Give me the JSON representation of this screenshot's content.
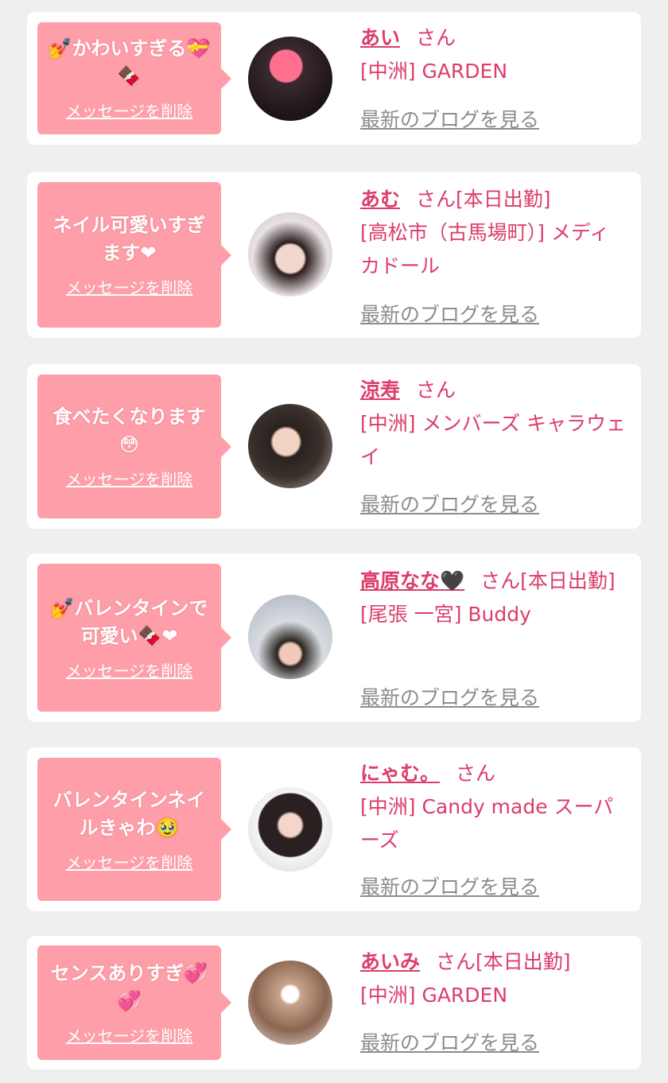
{
  "colors": {
    "background": "#efefef",
    "card": "#ffffff",
    "bubble": "#fd9ea8",
    "name_text": "#dc3d6a",
    "blog_link": "#8c8c8c"
  },
  "delete_label": "メッセージを削除",
  "blog_label": "最新のブログを見る",
  "san_label": "さん",
  "entries": [
    {
      "message": "💅かわいすぎる💝🍫",
      "name": "あい",
      "status": "",
      "shop": "[中洲] GARDEN"
    },
    {
      "message": "ネイル可愛いすぎます❤",
      "name": "あむ",
      "status": "[本日出勤]",
      "shop": "[高松市（古馬場町）] メディカドール"
    },
    {
      "message": "食べたくなります😳",
      "name": "涼寿",
      "status": "",
      "shop": "[中洲] メンバーズ キャラウェイ"
    },
    {
      "message": "💅バレンタインで可愛い🍫❤",
      "name": "高原なな🖤",
      "status": "[本日出勤]",
      "shop": "[尾張 一宮] Buddy"
    },
    {
      "message": "バレンタインネイルきゃわ🥹",
      "name": "にゃむ。",
      "status": "",
      "shop": "[中洲] Candy made スーパーズ"
    },
    {
      "message": "センスありすぎ💞💞",
      "name": "あいみ",
      "status": "[本日出勤]",
      "shop": "[中洲] GARDEN"
    }
  ]
}
